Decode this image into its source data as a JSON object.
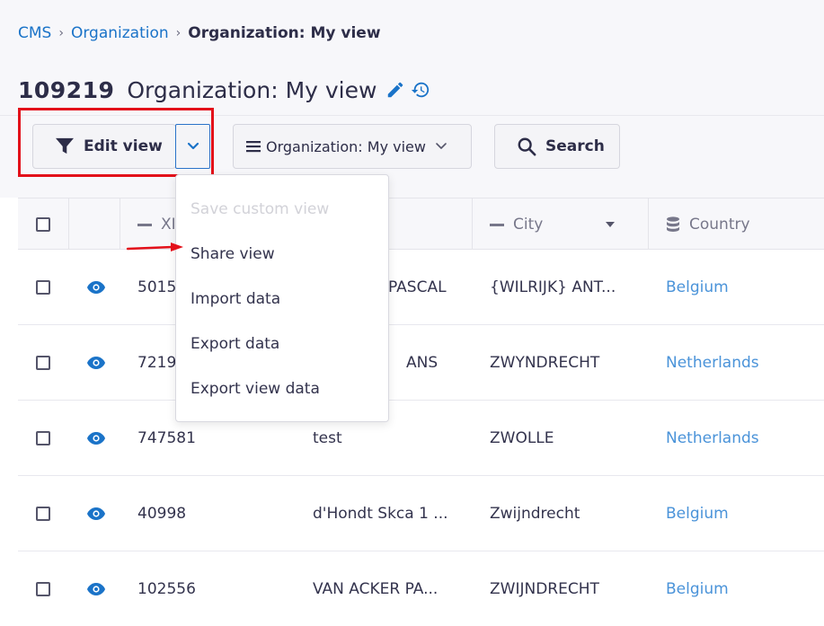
{
  "breadcrumb": {
    "items": [
      "CMS",
      "Organization"
    ],
    "current": "Organization: My view",
    "separator": "›"
  },
  "header": {
    "record_id": "109219",
    "title": "Organization: My view"
  },
  "toolbar": {
    "edit_view_label": "Edit view",
    "view_select_label": "Organization: My view",
    "search_label": "Search"
  },
  "menu": {
    "items": [
      {
        "label": "Save custom view",
        "disabled": true
      },
      {
        "label": "Share view",
        "disabled": false
      },
      {
        "label": "Import data",
        "disabled": false
      },
      {
        "label": "Export data",
        "disabled": false
      },
      {
        "label": "Export view data",
        "disabled": false
      }
    ]
  },
  "table": {
    "columns": [
      "XI",
      "City",
      "Country"
    ],
    "rows": [
      {
        "id": "5015",
        "name": "PASCAL",
        "city": "{WILRIJK} ANT...",
        "country": "Belgium"
      },
      {
        "id": "7219",
        "name": "ANS",
        "city": "ZWYNDRECHT",
        "country": "Netherlands"
      },
      {
        "id": "747581",
        "name": "test",
        "city": "ZWOLLE",
        "country": "Netherlands"
      },
      {
        "id": "40998",
        "name": "d'Hondt Skca 1 ...",
        "city": "Zwijndrecht",
        "country": "Belgium"
      },
      {
        "id": "102556",
        "name": "VAN ACKER PA...",
        "city": "ZWIJNDRECHT",
        "country": "Belgium"
      }
    ]
  },
  "colors": {
    "link": "#1a73c8",
    "country_link": "#4a93d9",
    "highlight": "#e3101a",
    "title": "#2d2d48"
  }
}
